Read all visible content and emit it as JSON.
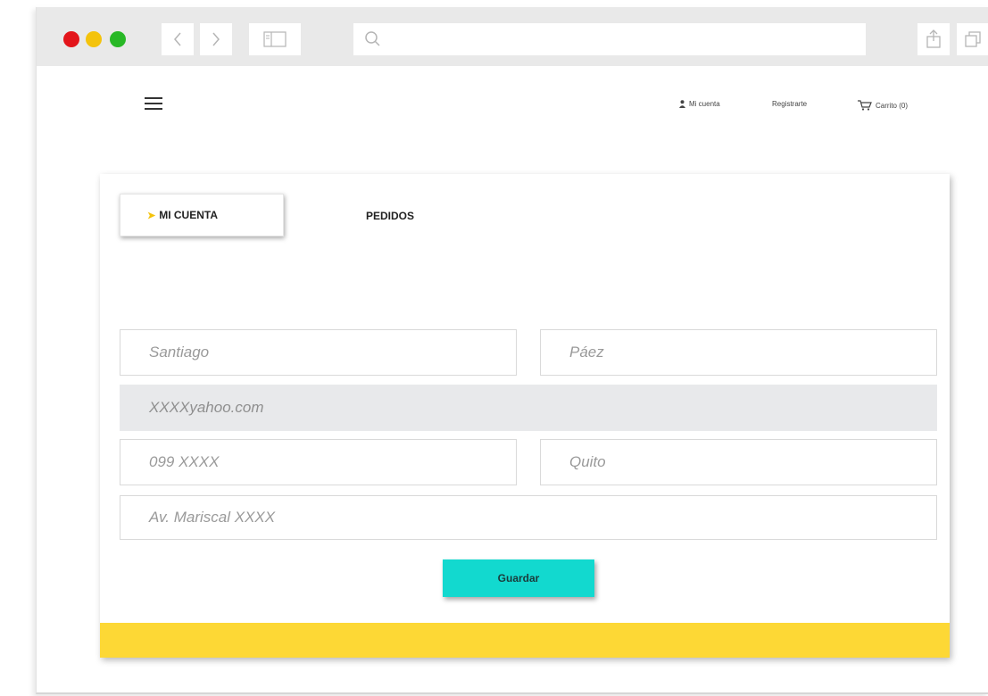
{
  "colors": {
    "close": "#e3151b",
    "minimize": "#f4c30c",
    "maximize": "#28b826",
    "accent_yellow": "#fdd835",
    "save_button": "#12d9cf"
  },
  "browser": {
    "icons": [
      "back-icon",
      "forward-icon",
      "sidebar-icon",
      "search-icon",
      "share-icon",
      "tabs-icon"
    ]
  },
  "header": {
    "account_link": "Mi cuenta",
    "register_link": "Registrarte",
    "cart_link": "Carrito (0)"
  },
  "tabs": {
    "account": "MI CUENTA",
    "orders": "PEDIDOS"
  },
  "form": {
    "first_name": "Santiago",
    "last_name": "Páez",
    "email": "XXXXyahoo.com",
    "phone": "099 XXXX",
    "city": "Quito",
    "address": "Av. Mariscal XXXX",
    "save_label": "Guardar"
  }
}
